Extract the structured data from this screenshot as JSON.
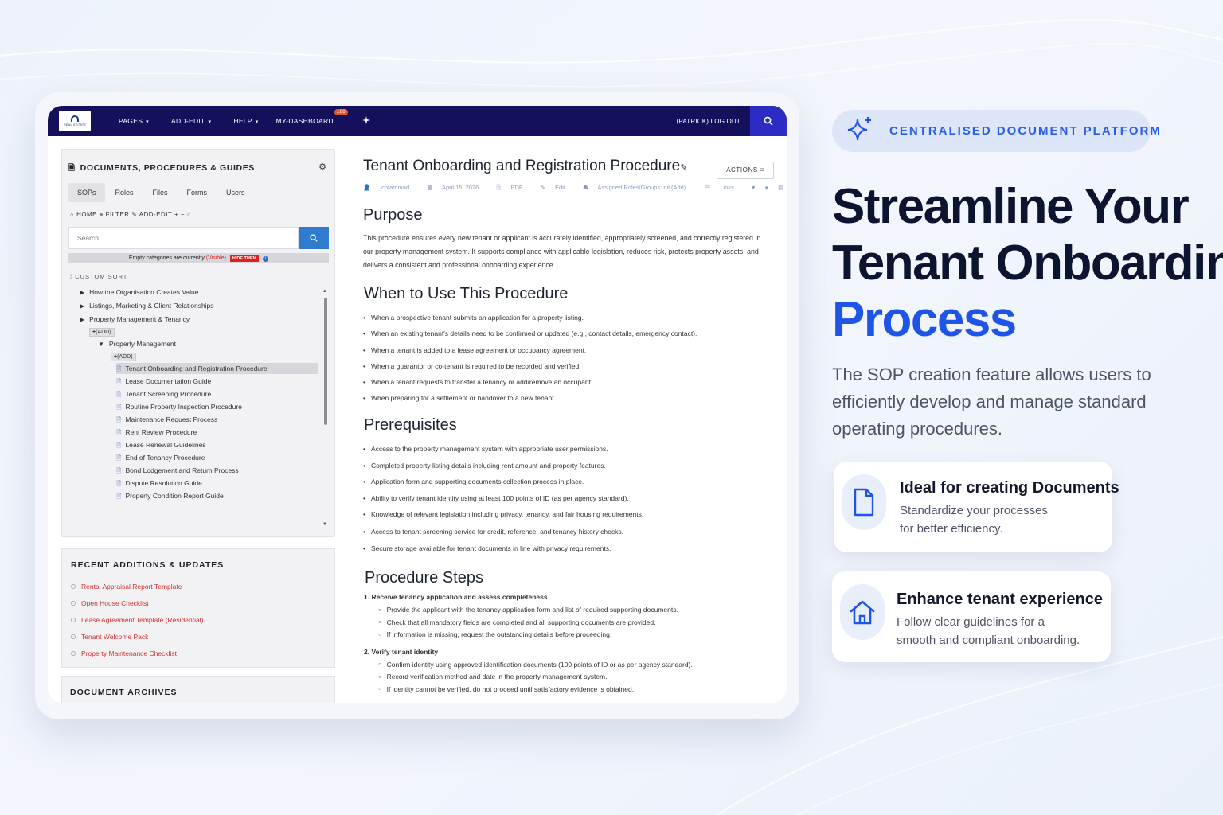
{
  "app": {
    "logo_text": "REAL ESTATE",
    "nav": [
      {
        "label": "PAGES"
      },
      {
        "label": "ADD-EDIT"
      },
      {
        "label": "HELP"
      },
      {
        "label": "MY-DASHBOARD",
        "badge": "186"
      }
    ],
    "logout": "(PATRICK) LOG OUT"
  },
  "sidebar": {
    "title": "DOCUMENTS, PROCEDURES & GUIDES",
    "tabs": [
      "SOPs",
      "Roles",
      "Files",
      "Forms",
      "Users"
    ],
    "active_tab": "SOPs",
    "crumbs": {
      "home": "HOME",
      "filter": "FILTER",
      "addedit": "ADD-EDIT"
    },
    "search_placeholder": "Search...",
    "notice": {
      "text": "Empty categories are currently",
      "visible": "(Visible)",
      "hide": "HIDE THEM"
    },
    "sort_label": "CUSTOM SORT",
    "tree": {
      "cat1": "How the Organisation Creates Value",
      "cat2": "Listings, Marketing & Client Relationships",
      "cat3": "Property Management & Tenancy",
      "add1": "(ADD)",
      "sub1": "Property Management",
      "add2": "(ADD)",
      "docs": [
        "Tenant Onboarding and Registration Procedure",
        "Lease Documentation Guide",
        "Tenant Screening Procedure",
        "Routine Property Inspection Procedure",
        "Maintenance Request Process",
        "Rent Review Procedure",
        "Lease Renewal Guidelines",
        "End of Tenancy Procedure",
        "Bond Lodgement and Return Process",
        "Dispute Resolution Guide",
        "Property Condition Report Guide"
      ]
    },
    "recent_title": "RECENT ADDITIONS & UPDATES",
    "recent": [
      "Rental Appraisal Report Template",
      "Open House Checklist",
      "Lease Agreement Template (Residential)",
      "Tenant Welcome Pack",
      "Property Maintenance Checklist"
    ],
    "archives_title": "DOCUMENT ARCHIVES"
  },
  "doc": {
    "title": "Tenant Onboarding and Registration Procedure",
    "actions": "ACTIONS",
    "meta": {
      "author": "jcotammad",
      "date": "April 15, 2026",
      "pdf": "PDF",
      "edit": "Edit",
      "assigned": "Assigned Roles/Groups: nil (Add).",
      "links": "Links"
    },
    "purpose_h": "Purpose",
    "purpose": "This procedure ensures every new tenant or applicant is accurately identified, appropriately screened, and correctly registered in our property management system. It supports compliance with applicable legislation, reduces risk, protects property assets, and delivers a consistent and professional onboarding experience.",
    "when_h": "When to Use This Procedure",
    "when": [
      "When a prospective tenant submits an application for a property listing.",
      "When an existing tenant's details need to be confirmed or updated (e.g., contact details, emergency contact).",
      "When a tenant is added to a lease agreement or occupancy agreement.",
      "When a guarantor or co-tenant is required to be recorded and verified.",
      "When a tenant requests to transfer a tenancy or add/remove an occupant.",
      "When preparing for a settlement or handover to a new tenant."
    ],
    "prereq_h": "Prerequisites",
    "prereq": [
      "Access to the property management system with appropriate user permissions.",
      "Completed property listing details including rent amount and property features.",
      "Application form and supporting documents collection process in place.",
      "Ability to verify tenant identity using at least 100 points of ID (as per agency standard).",
      "Knowledge of relevant legislation including privacy, tenancy, and fair housing requirements.",
      "Access to tenant screening service for credit, reference, and tenancy history checks.",
      "Secure storage available for tenant documents in line with privacy requirements."
    ],
    "steps_h": "Procedure Steps",
    "steps": [
      {
        "title": "1.  Receive tenancy application and assess completeness",
        "subs": [
          "Provide the applicant with the tenancy application form and list of required supporting documents.",
          "Check that all mandatory fields are completed and all supporting documents are provided.",
          "If information is missing, request the outstanding details before proceeding."
        ]
      },
      {
        "title": "2.  Verify tenant identity",
        "subs": [
          "Confirm identity using approved identification documents (100 points of ID or as per agency standard).",
          "Record verification method and date in the property management system.",
          "If identity cannot be verified, do not proceed until satisfactory evidence is obtained."
        ]
      }
    ]
  },
  "hero": {
    "pill": "CENTRALISED DOCUMENT PLATFORM",
    "line1": "Streamline Your",
    "line2": "Tenant Onboarding",
    "line3": "Process",
    "sub": "The SOP creation feature allows users to efficiently develop and manage standard operating procedures.",
    "card1": {
      "title": "Ideal for creating Documents",
      "line1": "Standardize your processes",
      "line2": "for better efficiency."
    },
    "card2": {
      "title": "Enhance tenant experience",
      "line1": "Follow clear guidelines for a",
      "line2": "smooth and compliant onboarding."
    }
  },
  "colors": {
    "nav_bg": "#14105c",
    "accent": "#1f55e6",
    "link_red": "#d03030"
  }
}
